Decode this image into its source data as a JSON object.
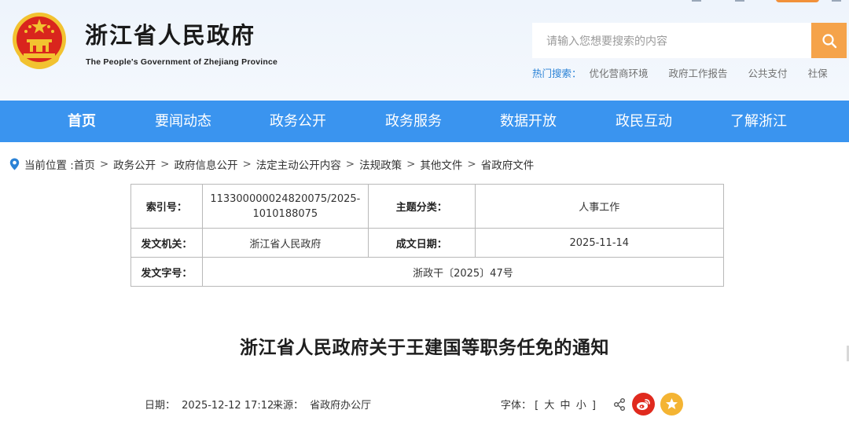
{
  "header": {
    "title": "浙江省人民政府",
    "subtitle": "The People's Government of Zhejiang Province",
    "emblem_icon": "national-emblem-icon"
  },
  "search": {
    "placeholder": "请输入您想要搜索的内容",
    "button_icon": "search-icon",
    "hot_label": "热门搜索：",
    "hot_items": [
      "优化营商环境",
      "政府工作报告",
      "公共支付",
      "社保"
    ]
  },
  "nav": {
    "items": [
      "首页",
      "要闻动态",
      "政务公开",
      "政务服务",
      "数据开放",
      "政民互动",
      "了解浙江"
    ],
    "active_index": 0
  },
  "breadcrumb": {
    "prefix": "当前位置 :",
    "items": [
      "首页",
      "政务公开",
      "政府信息公开",
      "法定主动公开内容",
      "法规政策",
      "其他文件",
      "省政府文件"
    ],
    "separator": ">"
  },
  "info": {
    "index_label": "索引号：",
    "index_value": "113300000024820075/2025-1010188075",
    "topic_label": "主题分类：",
    "topic_value": "人事工作",
    "issuer_label": "发文机关：",
    "issuer_value": "浙江省人民政府",
    "date_label": "成文日期：",
    "date_value": "2025-11-14",
    "docno_label": "发文字号：",
    "docno_value": "浙政干〔2025〕47号"
  },
  "article": {
    "title": "浙江省人民政府关于王建国等职务任免的通知",
    "date_label": "日期：",
    "date_value": "2025-12-12 17:12",
    "source_label": "来源：",
    "source_value": "省政府办公厅",
    "font_label": "字体：",
    "font_open": "[",
    "font_sizes": [
      "大",
      "中",
      "小"
    ],
    "font_close": "]"
  },
  "colors": {
    "nav_blue": "#3a94ef",
    "search_orange": "#f5a34a",
    "hot_label_blue": "#2a82d6",
    "weibo_red": "#e02a1e",
    "fav_yellow": "#f4b433"
  }
}
